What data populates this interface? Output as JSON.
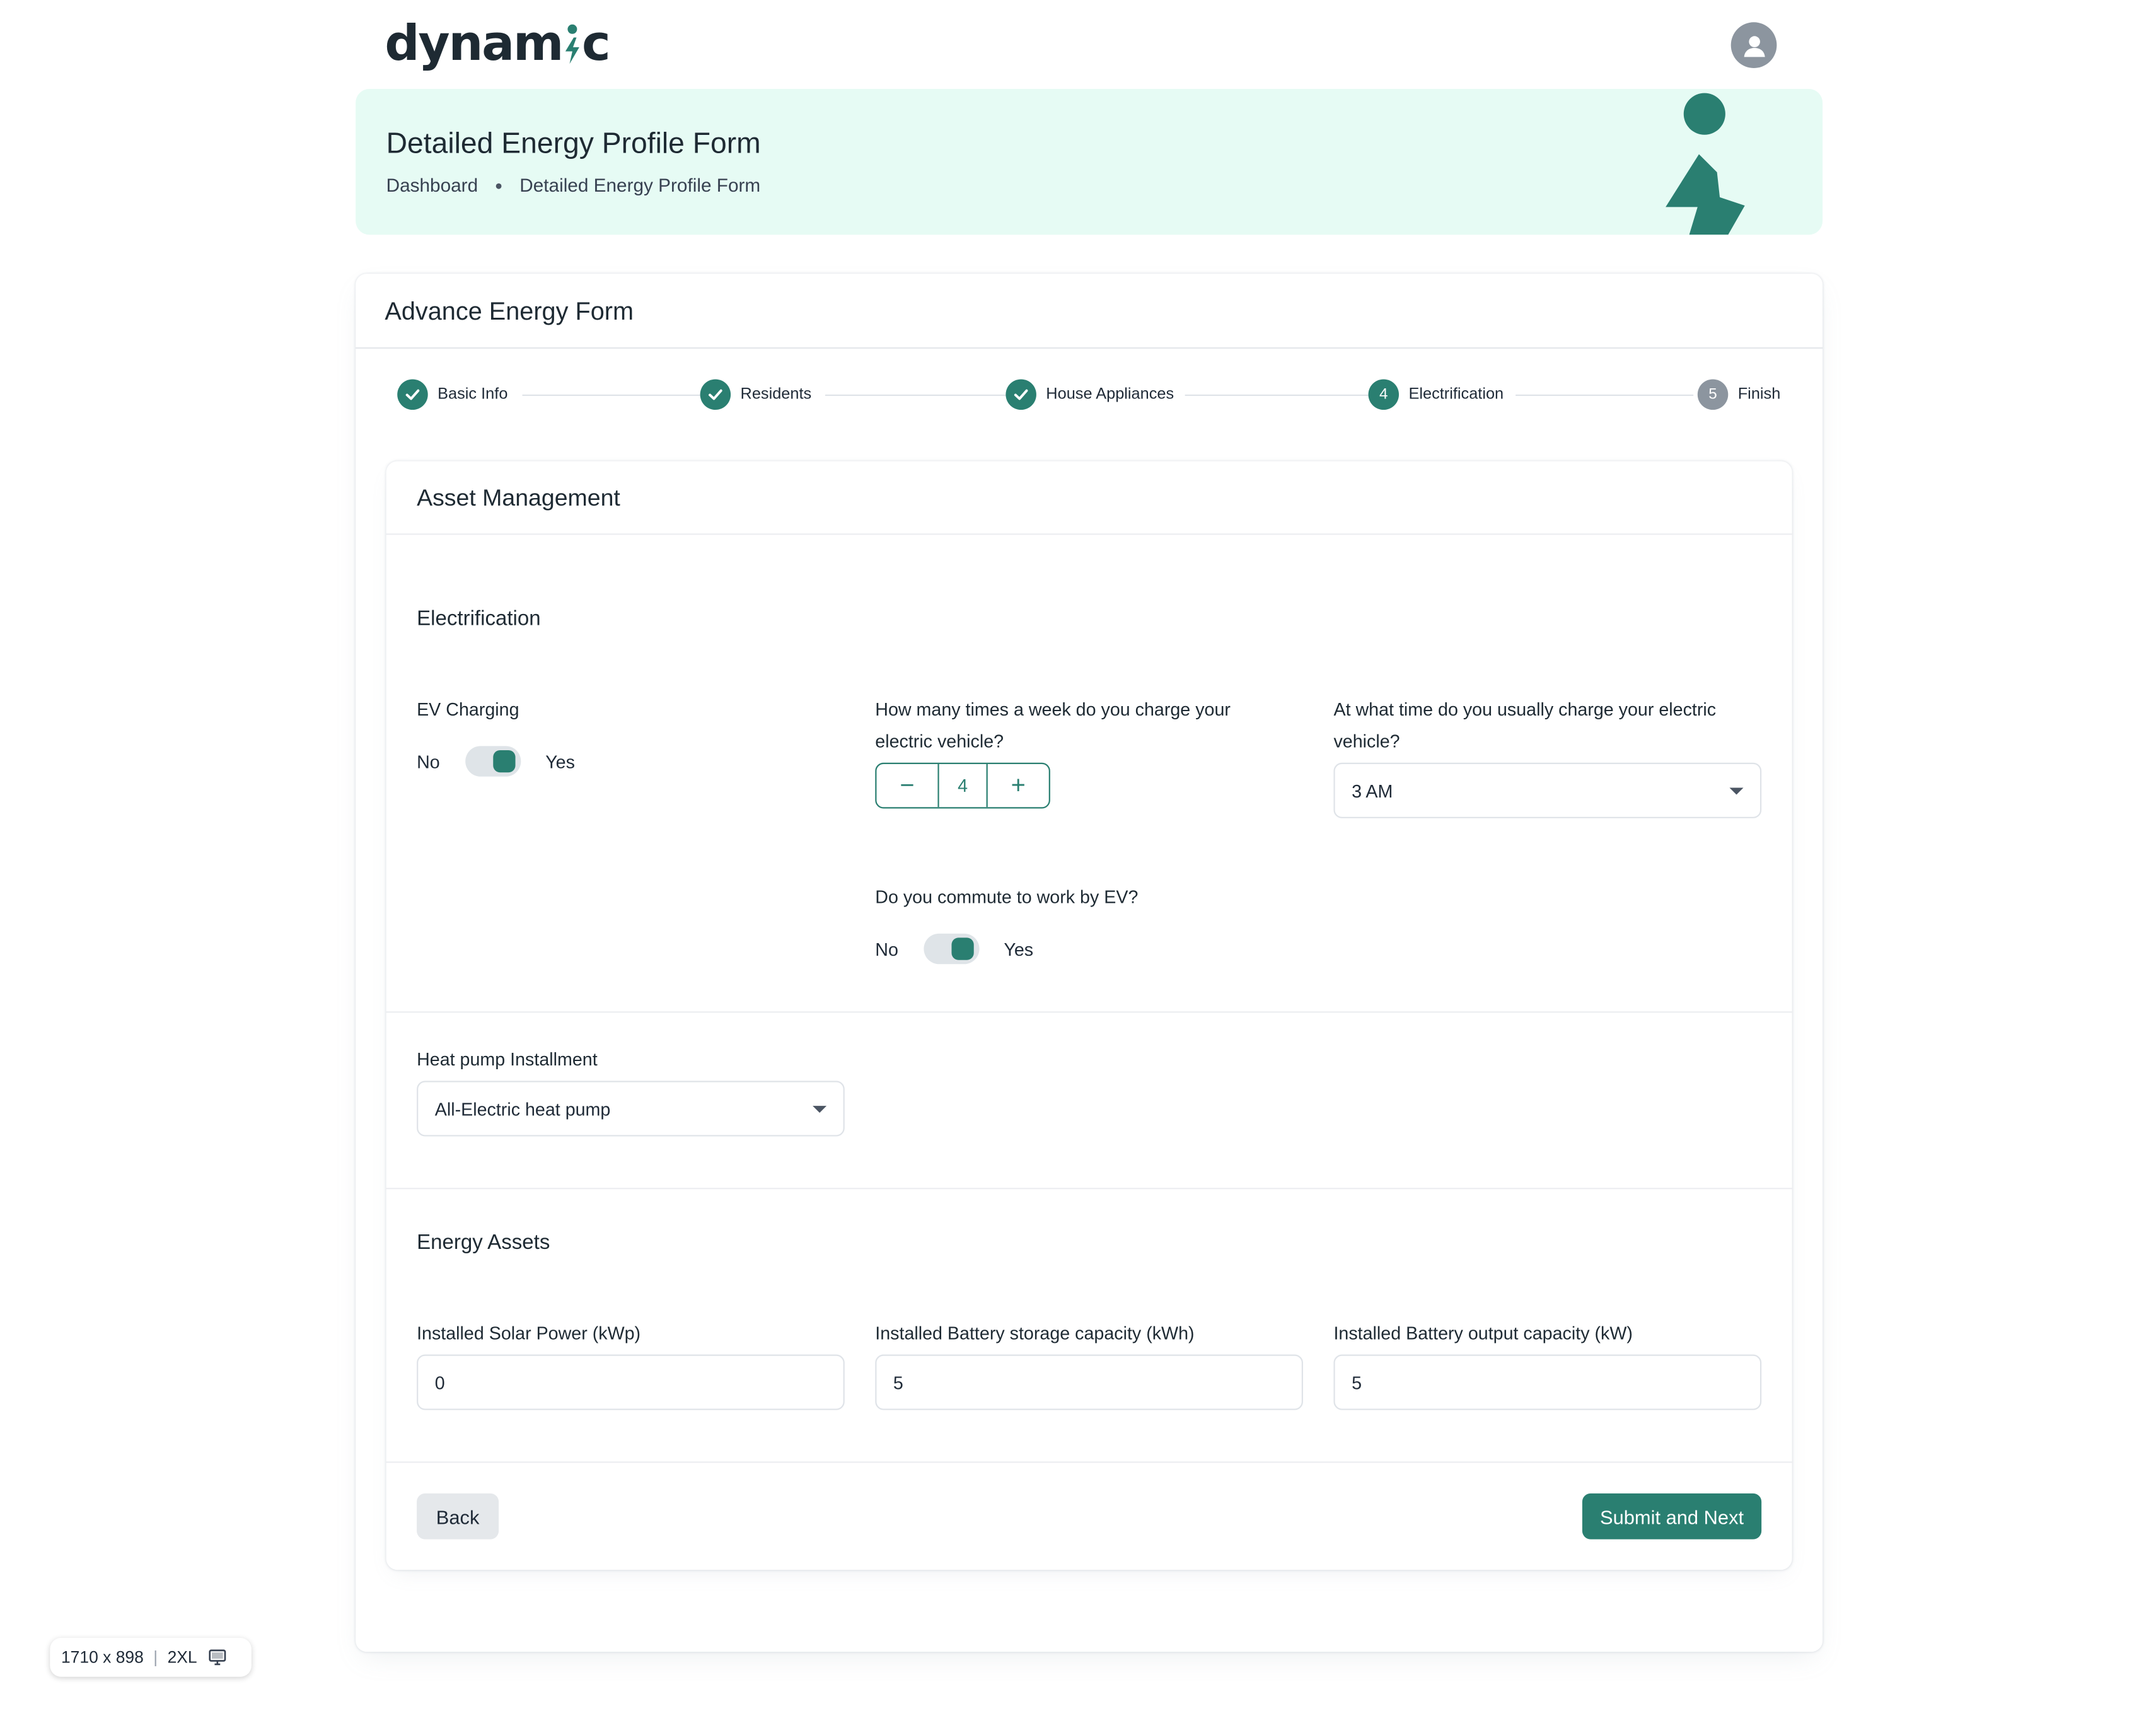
{
  "brand": {
    "logo_text_1": "dynam",
    "logo_text_2": "c"
  },
  "header": {
    "title": "Detailed Energy Profile Form",
    "breadcrumbs": [
      "Dashboard",
      "Detailed Energy Profile Form"
    ]
  },
  "form": {
    "title": "Advance Energy Form",
    "steps": [
      {
        "label": "Basic Info",
        "status": "done"
      },
      {
        "label": "Residents",
        "status": "done"
      },
      {
        "label": "House Appliances",
        "status": "done"
      },
      {
        "label": "Electrification",
        "status": "active",
        "number": "4"
      },
      {
        "label": "Finish",
        "status": "todo",
        "number": "5"
      }
    ]
  },
  "asset": {
    "title": "Asset Management",
    "electrification": {
      "title": "Electrification",
      "ev_charging": {
        "label": "EV Charging",
        "no": "No",
        "yes": "Yes",
        "value": true
      },
      "charges_per_week": {
        "label": "How many times a week do you charge your electric vehicle?",
        "value": "4",
        "minus": "−",
        "plus": "+"
      },
      "charge_time": {
        "label": "At what time do you usually charge your electric vehicle?",
        "value": "3 AM"
      },
      "commute": {
        "label": "Do you commute to work by EV?",
        "no": "No",
        "yes": "Yes",
        "value": true
      }
    },
    "heat_pump": {
      "label": "Heat pump Installment",
      "value": "All-Electric heat pump"
    },
    "energy_assets": {
      "title": "Energy Assets",
      "solar": {
        "label": "Installed Solar Power (kWp)",
        "value": "0"
      },
      "battery_storage": {
        "label": "Installed Battery storage capacity (kWh)",
        "value": "5"
      },
      "battery_output": {
        "label": "Installed Battery output capacity (kW)",
        "value": "5"
      }
    },
    "buttons": {
      "back": "Back",
      "submit": "Submit and Next"
    }
  },
  "viewport_badge": {
    "size": "1710 x 898",
    "breakpoint": "2XL"
  },
  "colors": {
    "accent": "#2a7f71",
    "banner_bg": "#e6fbf4",
    "muted": "#8c959f"
  }
}
